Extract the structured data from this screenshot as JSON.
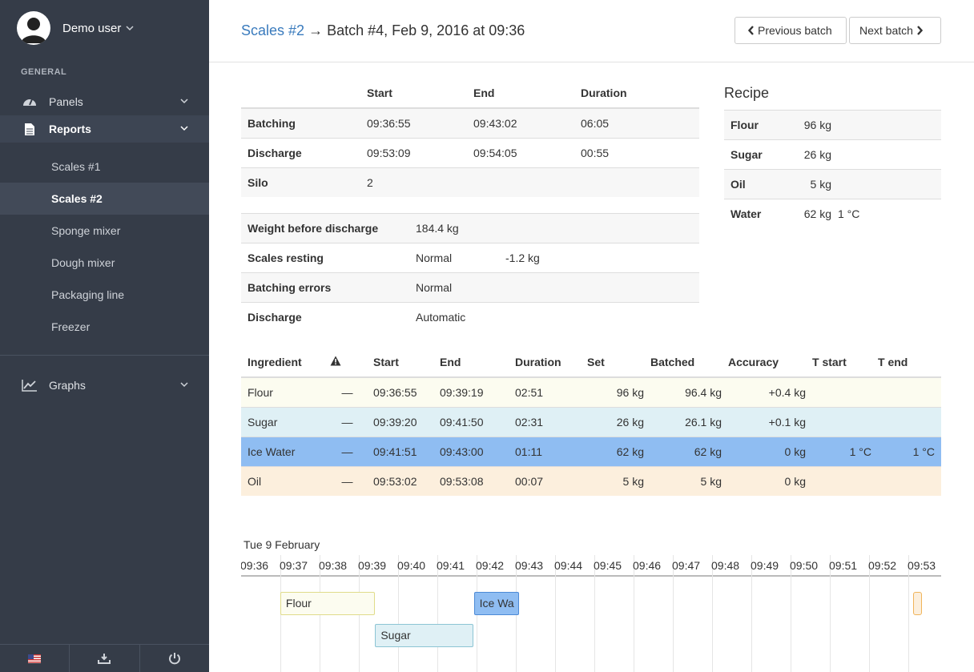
{
  "user": {
    "name": "Demo user"
  },
  "sidebar": {
    "section": "GENERAL",
    "items": [
      {
        "label": "Panels"
      },
      {
        "label": "Reports"
      }
    ],
    "sub_items": [
      "Scales #1",
      "Scales #2",
      "Sponge mixer",
      "Dough mixer",
      "Packaging line",
      "Freezer"
    ],
    "graphs": "Graphs"
  },
  "header": {
    "link": "Scales #2",
    "arrow": "→",
    "title": "Batch #4, Feb 9, 2016 at 09:36",
    "prev": "Previous batch",
    "next": "Next batch"
  },
  "times": {
    "headers": [
      "Start",
      "End",
      "Duration"
    ],
    "rows": [
      {
        "label": "Batching",
        "start": "09:36:55",
        "end": "09:43:02",
        "duration": "06:05"
      },
      {
        "label": "Discharge",
        "start": "09:53:09",
        "end": "09:54:05",
        "duration": "00:55"
      },
      {
        "label": "Silo",
        "start": "2",
        "end": "",
        "duration": ""
      }
    ]
  },
  "details": [
    {
      "label": "Weight before discharge",
      "value": "184.4 kg",
      "extra": ""
    },
    {
      "label": "Scales resting",
      "value": "Normal",
      "extra": "-1.2 kg"
    },
    {
      "label": "Batching errors",
      "value": "Normal",
      "extra": ""
    },
    {
      "label": "Discharge",
      "value": "Automatic",
      "extra": ""
    }
  ],
  "recipe": {
    "title": "Recipe",
    "rows": [
      {
        "name": "Flour",
        "amount": "96 kg",
        "temp": ""
      },
      {
        "name": "Sugar",
        "amount": "26 kg",
        "temp": ""
      },
      {
        "name": "Oil",
        "amount": "5 kg",
        "temp": ""
      },
      {
        "name": "Water",
        "amount": "62 kg",
        "temp": "1 °C"
      }
    ]
  },
  "ingredients": {
    "headers": [
      "Ingredient",
      "Start",
      "End",
      "Duration",
      "Set",
      "Batched",
      "Accuracy",
      "T start",
      "T end"
    ],
    "rows": [
      {
        "name": "Flour",
        "warn": "—",
        "start": "09:36:55",
        "end": "09:39:19",
        "duration": "02:51",
        "set": "96 kg",
        "batched": "96.4 kg",
        "accuracy": "+0.4 kg",
        "tstart": "",
        "tend": ""
      },
      {
        "name": "Sugar",
        "warn": "—",
        "start": "09:39:20",
        "end": "09:41:50",
        "duration": "02:31",
        "set": "26 kg",
        "batched": "26.1 kg",
        "accuracy": "+0.1 kg",
        "tstart": "",
        "tend": ""
      },
      {
        "name": "Ice Water",
        "warn": "—",
        "start": "09:41:51",
        "end": "09:43:00",
        "duration": "01:11",
        "set": "62 kg",
        "batched": "62 kg",
        "accuracy": "0 kg",
        "tstart": "1 °C",
        "tend": "1 °C"
      },
      {
        "name": "Oil",
        "warn": "—",
        "start": "09:53:02",
        "end": "09:53:08",
        "duration": "00:07",
        "set": "5 kg",
        "batched": "5 kg",
        "accuracy": "0 kg",
        "tstart": "",
        "tend": ""
      }
    ]
  },
  "timeline": {
    "date": "Tue 9 February",
    "ticks": [
      "09:36",
      "09:37",
      "09:38",
      "09:39",
      "09:40",
      "09:41",
      "09:42",
      "09:43",
      "09:44",
      "09:45",
      "09:46",
      "09:47",
      "09:48",
      "09:49",
      "09:50",
      "09:51",
      "09:52",
      "09:53"
    ],
    "bars": [
      {
        "label": "Flour",
        "start": "09:36:55",
        "end": "09:39:19",
        "color": "#fcfcf0",
        "border": "#e0dc8a"
      },
      {
        "label": "Sugar",
        "start": "09:39:20",
        "end": "09:41:50",
        "color": "#dff0f5",
        "border": "#8cc4d4"
      },
      {
        "label": "Ice Wa",
        "start": "09:41:51",
        "end": "09:43:00",
        "color": "#8fbdf2",
        "border": "#4d8ad6"
      },
      {
        "label": "",
        "start": "09:53:02",
        "end": "09:53:08",
        "color": "#fcefdd",
        "border": "#f0b45a"
      }
    ]
  },
  "colors": {
    "sidebar": "#353c48",
    "link": "#3a7bbd"
  }
}
